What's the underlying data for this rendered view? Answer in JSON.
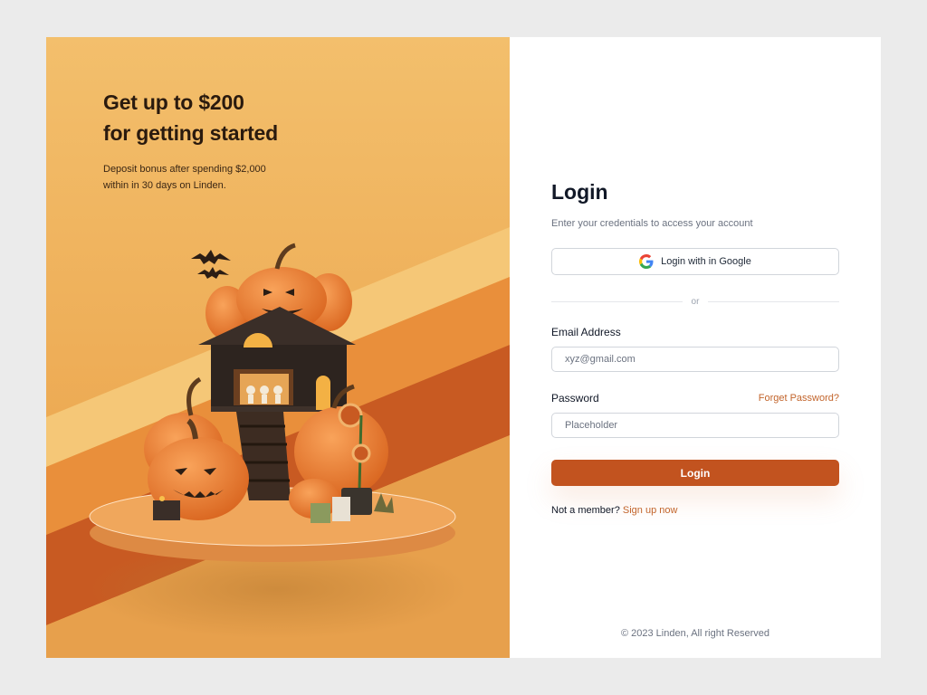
{
  "promo": {
    "title_line1": "Get up to $200",
    "title_line2": "for getting started",
    "subtitle_line1": "Deposit bonus after spending $2,000",
    "subtitle_line2": "within in 30 days on Linden."
  },
  "login": {
    "title": "Login",
    "subtitle": "Enter your credentials to access your account",
    "google_label": "Login with in Google",
    "divider_text": "or",
    "email_label": "Email Address",
    "email_placeholder": "xyz@gmail.com",
    "password_label": "Password",
    "forgot_label": "Forget Password?",
    "password_placeholder": "Placeholder",
    "submit_label": "Login",
    "not_member_text": "Not a member?",
    "signup_label": "Sign up now"
  },
  "footer": {
    "copyright": "© 2023 Linden, All right Reserved"
  },
  "colors": {
    "accent": "#c2531f",
    "link": "#c2642b",
    "panel_orange": "#eea853"
  },
  "icons": [
    "google-icon",
    "halloween-illustration"
  ]
}
